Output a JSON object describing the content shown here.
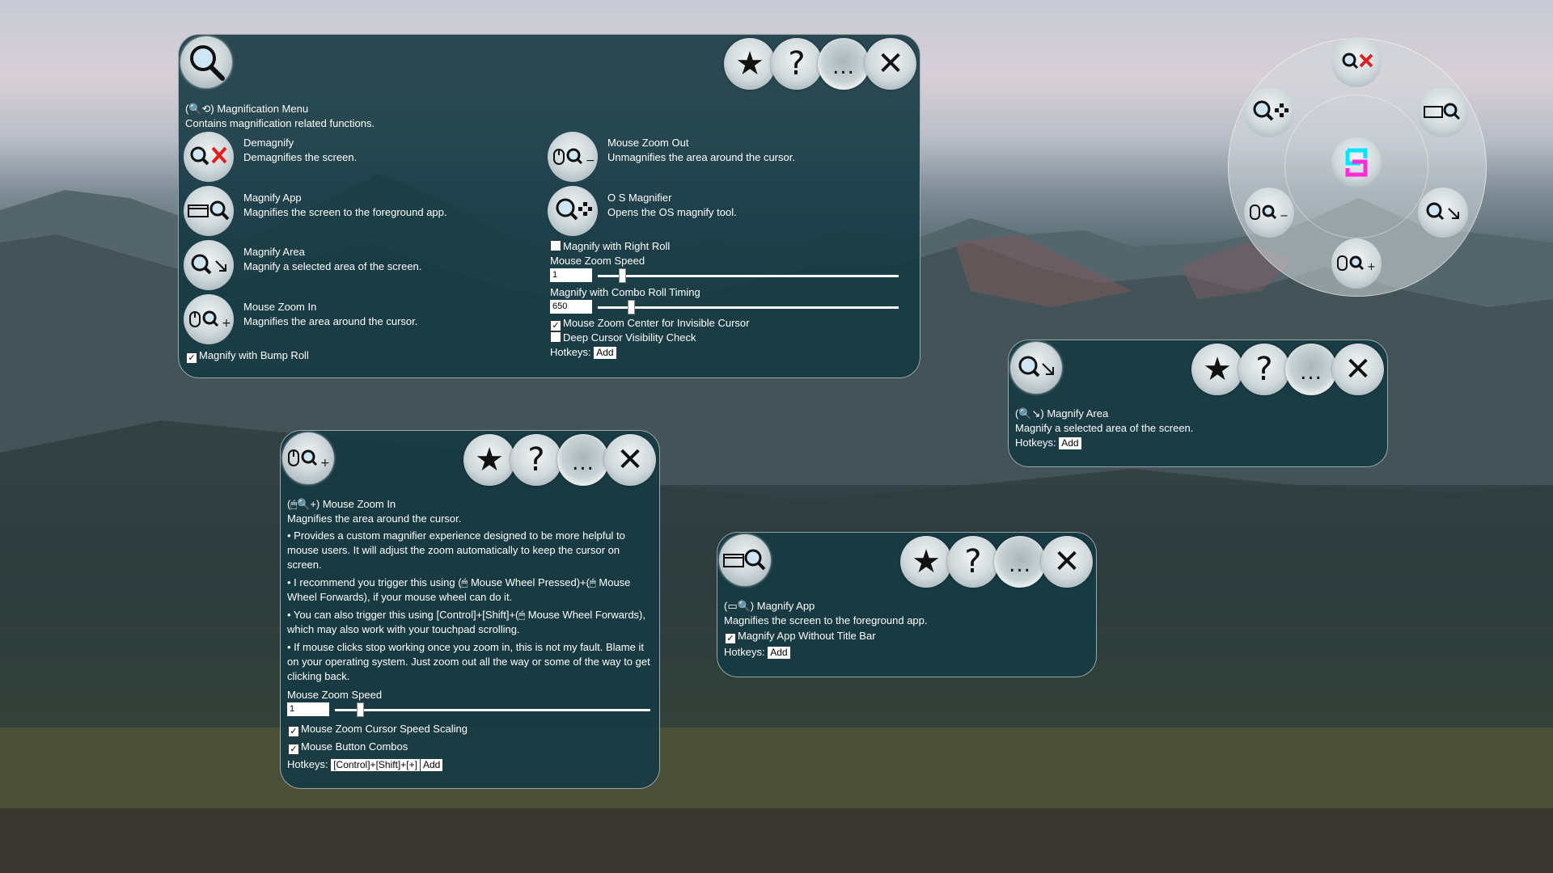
{
  "magnification_menu": {
    "title": "(🔍⟲)  Magnification Menu",
    "description": "Contains magnification related functions.",
    "items": [
      {
        "label": "Demagnify",
        "desc": "Demagnifies the screen."
      },
      {
        "label": "Magnify App",
        "desc": "Magnifies the screen to the foreground app."
      },
      {
        "label": "Magnify Area",
        "desc": "Magnify a selected area of the screen."
      },
      {
        "label": "Mouse Zoom In",
        "desc": "Magnifies the area around the cursor."
      },
      {
        "label": "Mouse Zoom Out",
        "desc": "Unmagnifies the area around the cursor."
      },
      {
        "label": "O S Magnifier",
        "desc": "Opens the OS magnify tool."
      }
    ],
    "bump_roll_label": "Magnify with Bump Roll",
    "right_roll_label": "Magnify with Right Roll",
    "zoom_speed_label": "Mouse Zoom Speed",
    "zoom_speed_value": "1",
    "zoom_speed_fraction": 0.08,
    "combo_timing_label": "Magnify with Combo Roll Timing",
    "combo_timing_value": "650",
    "combo_timing_fraction": 0.11,
    "center_invisible_label": "Mouse Zoom Center for Invisible Cursor",
    "deep_visibility_label": "Deep Cursor Visibility Check",
    "hotkeys_label": "Hotkeys:",
    "add_label": "Add"
  },
  "magnify_area": {
    "title": "(🔍↘)  Magnify Area",
    "desc": "Magnify a selected area of the screen.",
    "hotkeys_label": "Hotkeys:",
    "add_label": "Add"
  },
  "mouse_zoom_in": {
    "title": "(🖱🔍+)  Mouse Zoom In",
    "desc": "Magnifies the area around the cursor.",
    "bullets": [
      "• Provides a custom magnifier experience designed to be more helpful to mouse users.  It will adjust the zoom automatically to keep the cursor on screen.",
      "• I recommend you trigger this using (🖱 Mouse Wheel Pressed)+(🖱 Mouse Wheel Forwards), if your mouse wheel can do it.",
      "• You can also trigger this using [Control]+[Shift]+(🖱 Mouse Wheel Forwards), which may also work with your touchpad scrolling.",
      "• If mouse clicks stop working once you zoom in, this is not my fault.  Blame it on your operating system.  Just zoom out all the way or some of the way to get clicking back."
    ],
    "zoom_speed_label": "Mouse Zoom Speed",
    "zoom_speed_value": "1",
    "zoom_speed_fraction": 0.08,
    "speed_scaling_label": "Mouse Zoom Cursor Speed Scaling",
    "button_combos_label": "Mouse Button Combos",
    "hotkeys_label": "Hotkeys:",
    "hotkey_value": "[Control]+[Shift]+[+]",
    "add_label": "Add"
  },
  "magnify_app": {
    "title": "(▭🔍)  Magnify App",
    "desc": "Magnifies the screen to the foreground app.",
    "without_title_bar_label": "Magnify App Without Title Bar",
    "hotkeys_label": "Hotkeys:",
    "add_label": "Add"
  },
  "controls": {
    "favorite": "★",
    "help": "?",
    "more": "...",
    "close": "✕"
  },
  "colors": {
    "panel_bg": "#163a44",
    "demagnify_x": "#e02020"
  }
}
